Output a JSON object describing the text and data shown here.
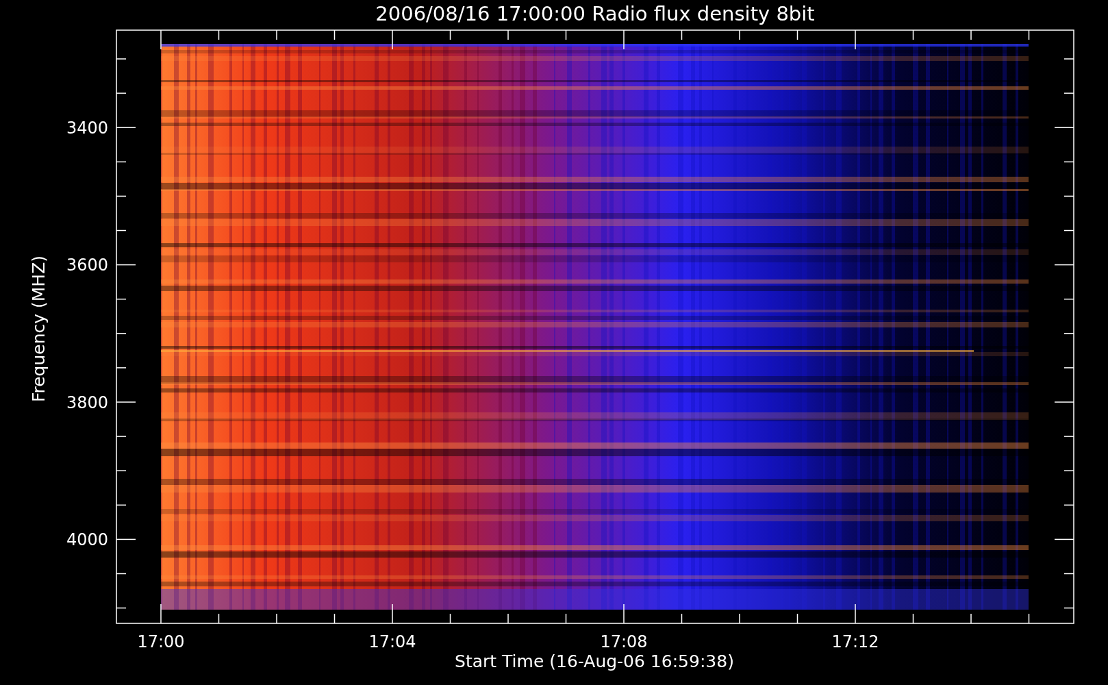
{
  "title": "2006/08/16 17:00:00 Radio flux density 8bit",
  "y_axis": {
    "label": "Frequency (MHZ)",
    "ticks": [
      "3400",
      "3600",
      "3800",
      "4000"
    ]
  },
  "x_axis": {
    "label": "Start Time (16-Aug-06 16:59:38)",
    "ticks": [
      "17:00",
      "17:04",
      "17:08",
      "17:12"
    ]
  }
}
